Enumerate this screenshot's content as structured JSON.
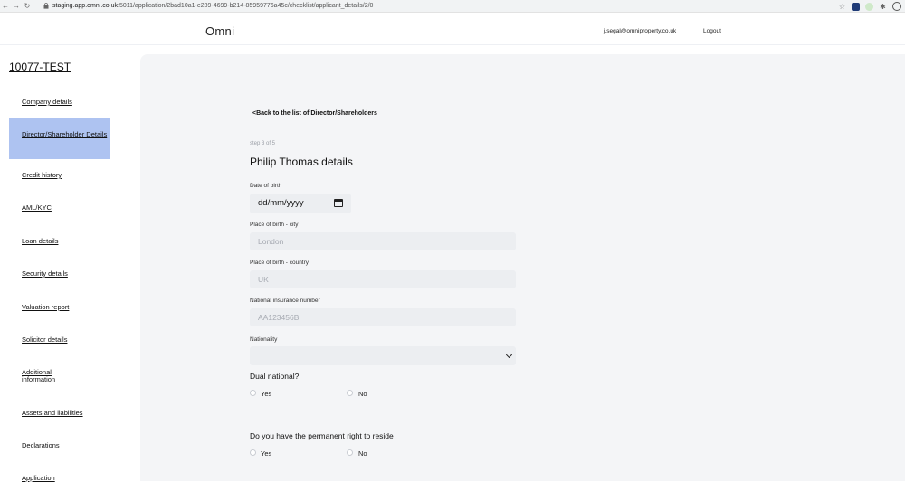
{
  "browser": {
    "url_host": "staging.app.omni.co.uk",
    "url_path": ":5011/application/2bad10a1-e289-4699-b214-85959776a45c/checklist/applicant_details/2/0"
  },
  "header": {
    "brand": "Omni",
    "user_email": "j.segal@omniproperty.co.uk",
    "logout_label": "Logout"
  },
  "sidebar": {
    "application_id": "10077-TEST",
    "items": [
      {
        "label": "Company details"
      },
      {
        "label": "Director/Shareholder Details",
        "active": true
      },
      {
        "label": "Credit history"
      },
      {
        "label": "AML/KYC"
      },
      {
        "label": "Loan details"
      },
      {
        "label": "Security details"
      },
      {
        "label": "Valuation report"
      },
      {
        "label": "Solicitor details"
      },
      {
        "label": "Additional information"
      },
      {
        "label": "Assets and liabilities"
      },
      {
        "label": "Declarations"
      },
      {
        "label": "Application"
      }
    ]
  },
  "main": {
    "back_link": "<Back to the list of Director/Shareholders",
    "step": "step 3 of 5",
    "title": "Philip Thomas details",
    "dob_label": "Date of birth",
    "dob_value": "dd/mm/yyyy",
    "city_label": "Place of birth - city",
    "city_value": "London",
    "country_label": "Place of birth - country",
    "country_value": "UK",
    "ni_label": "National insurance number",
    "ni_value": "AA123456B",
    "nationality_label": "Nationality",
    "nationality_value": "",
    "dual_question": "Dual national?",
    "reside_question": "Do you have the permanent right to reside",
    "yes_label": "Yes",
    "no_label": "No"
  },
  "colors": {
    "sidebar_active": "#aec3f1",
    "panel_bg": "#f4f5f7",
    "input_bg": "#eceef1"
  }
}
